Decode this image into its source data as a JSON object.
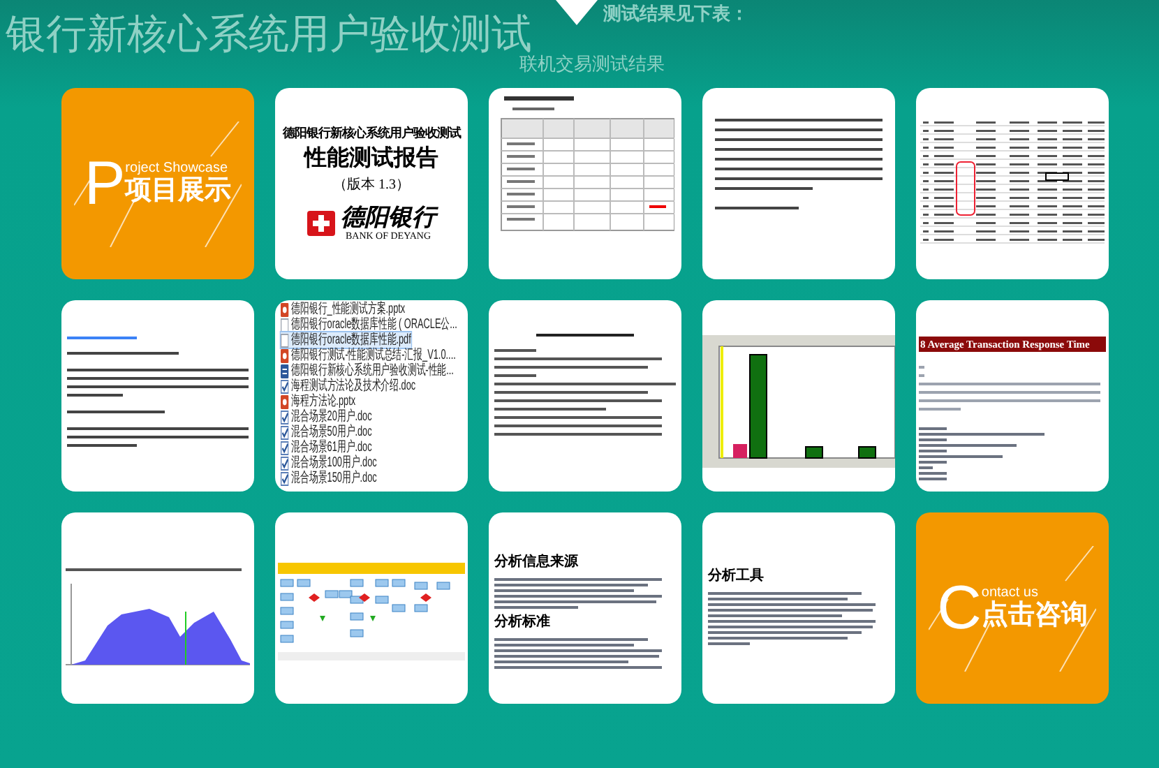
{
  "background": {
    "headline": "银行新核心系统用户验收测试",
    "note": "测试结果见下表：",
    "note_2": "联机交易测试结果"
  },
  "cards": [
    {
      "kind": "cover",
      "letter": "P",
      "tail": "roject Showcase",
      "title": "项目展示"
    },
    {
      "kind": "report",
      "title": "德阳银行新核心系统用户验收测试",
      "subtitle": "性能测试报告",
      "version": "（版本 1.3）",
      "bank_name": "德阳银行",
      "bank_name_en": "BANK OF DEYANG"
    },
    {
      "kind": "table"
    },
    {
      "kind": "paragraph"
    },
    {
      "kind": "spreadsheet"
    },
    {
      "kind": "notes"
    },
    {
      "kind": "files",
      "files": [
        {
          "kind": "ppt",
          "name": "德阳银行_性能测试方案.pptx",
          "selected": false
        },
        {
          "kind": "file",
          "name": "德阳银行oracle数据库性能 ( ORACLE公...",
          "selected": false
        },
        {
          "kind": "file",
          "name": "德阳银行oracle数据库性能.pdf",
          "selected": true
        },
        {
          "kind": "ppt",
          "name": "德阳银行测试-性能测试总结-汇报_V1.0....",
          "selected": false
        },
        {
          "kind": "word",
          "name": "德阳银行新核心系统用户验收测试-性能...",
          "selected": false
        },
        {
          "kind": "doc",
          "name": "海程测试方法论及技术介绍.doc",
          "selected": false
        },
        {
          "kind": "ppt",
          "name": "海程方法论.pptx",
          "selected": false
        },
        {
          "kind": "doc",
          "name": "混合场景20用户.doc",
          "selected": false
        },
        {
          "kind": "doc",
          "name": "混合场景50用户.doc",
          "selected": false
        },
        {
          "kind": "doc",
          "name": "混合场景61用户.doc",
          "selected": false
        },
        {
          "kind": "doc",
          "name": "混合场景100用户.doc",
          "selected": false
        },
        {
          "kind": "doc",
          "name": "混合场景150用户.doc",
          "selected": false
        }
      ]
    },
    {
      "kind": "memo"
    },
    {
      "kind": "bar_chart"
    },
    {
      "kind": "report_section",
      "heading": "8 Average Transaction Response Time"
    },
    {
      "kind": "area_chart"
    },
    {
      "kind": "flowchart"
    },
    {
      "kind": "analysis",
      "headings": [
        "分析信息来源",
        "分析标准"
      ]
    },
    {
      "kind": "analysis",
      "headings": [
        "分析工具"
      ]
    },
    {
      "kind": "cover",
      "letter": "C",
      "tail": "ontact us",
      "title": "点击咨询"
    }
  ]
}
